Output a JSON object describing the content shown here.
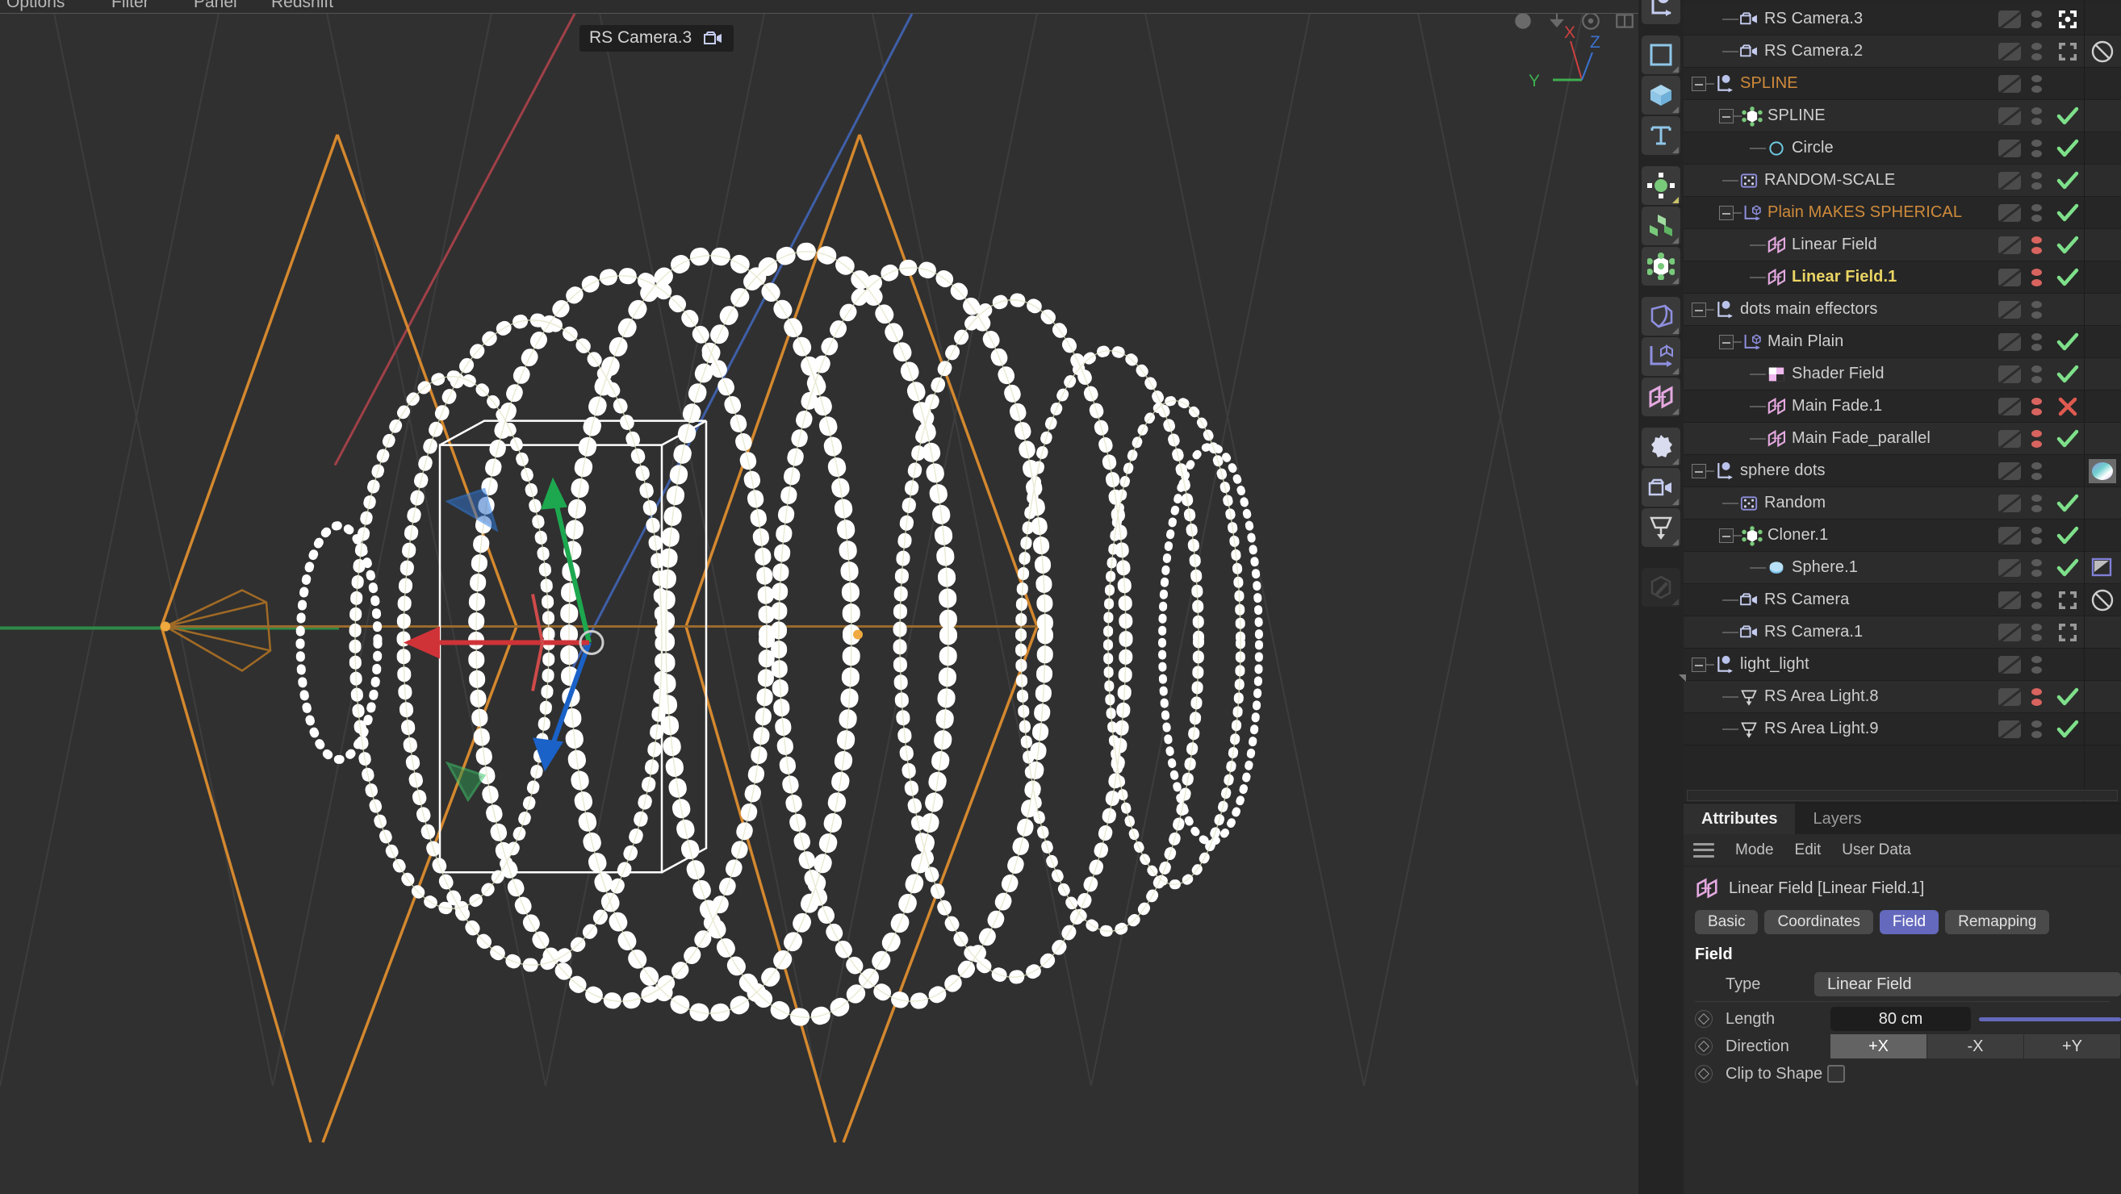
{
  "menubar": {
    "items": [
      "Options",
      "Filter",
      "Panel",
      "Redshift"
    ]
  },
  "viewport": {
    "camera_label": "RS Camera.3",
    "camera_icon": "camera-icon",
    "axis_gizmo": {
      "x": "X",
      "y": "Y",
      "z": "Z",
      "x_color": "#d0413f",
      "y_color": "#3fae4f",
      "z_color": "#3a73d0"
    },
    "top_icons": [
      "sphere-icon",
      "download-icon",
      "target-icon",
      "layout-icon"
    ],
    "background": "#303030",
    "grid_color": "#3d3d3d",
    "field_gizmo_color": "#d4882e",
    "clone_color": "#ffffff",
    "spline_color": "#e4e4c8"
  },
  "toolbar": {
    "items": [
      {
        "name": "null-object-icon",
        "color": "#c6cdf0",
        "group": 0
      },
      {
        "name": "plane-primitive-icon",
        "color": "#8fc6e8",
        "group": 1
      },
      {
        "name": "cube-primitive-icon",
        "color": "#8fc6e8",
        "group": 1
      },
      {
        "name": "text-primitive-icon",
        "color": "#8fc6e8",
        "group": 1
      },
      {
        "name": "mograph-array-icon",
        "color": "#78c97a",
        "group": 2
      },
      {
        "name": "mograph-clones-icon",
        "color": "#78c97a",
        "group": 2
      },
      {
        "name": "mograph-cloner-icon",
        "color": "#ffffff",
        "group": 2
      },
      {
        "name": "deformer-bend-icon",
        "color": "#8f8fe0",
        "group": 3
      },
      {
        "name": "effector-plain-icon",
        "color": "#8f8fe0",
        "group": 3
      },
      {
        "name": "linear-field-icon",
        "color": "#e4a9e0",
        "group": 3
      },
      {
        "name": "environment-icon",
        "color": "#c6cdf0",
        "group": 4
      },
      {
        "name": "camera-icon",
        "color": "#c6cdf0",
        "group": 4
      },
      {
        "name": "area-light-icon",
        "color": "#d5d5d5",
        "group": 4
      },
      {
        "name": "material-edit-icon",
        "color": "#5c5c5c",
        "group": 5
      }
    ]
  },
  "object_manager": {
    "rows": [
      {
        "label": "RS Camera.3",
        "icon": "camera-icon",
        "indent": 1,
        "expander": false,
        "color": "normal",
        "dots": "gray",
        "state": "frame-active",
        "extra": ""
      },
      {
        "label": "RS Camera.2",
        "icon": "camera-icon",
        "indent": 1,
        "expander": false,
        "color": "normal",
        "dots": "gray",
        "state": "frame",
        "extra": "no-icon"
      },
      {
        "label": "SPLINE",
        "icon": "null-object-icon",
        "indent": 0,
        "expander": true,
        "color": "orange",
        "dots": "gray",
        "state": "none",
        "extra": ""
      },
      {
        "label": "SPLINE",
        "icon": "cloner-icon",
        "indent": 1,
        "expander": true,
        "color": "normal",
        "dots": "gray",
        "state": "check",
        "extra": ""
      },
      {
        "label": "Circle",
        "icon": "circle-spline-icon",
        "indent": 2,
        "expander": false,
        "color": "normal",
        "dots": "gray",
        "state": "check",
        "extra": ""
      },
      {
        "label": "RANDOM-SCALE",
        "icon": "random-effector-icon",
        "indent": 1,
        "expander": false,
        "color": "normal",
        "dots": "gray",
        "state": "check",
        "extra": ""
      },
      {
        "label": "Plain MAKES SPHERICAL",
        "icon": "plain-effector-icon",
        "indent": 1,
        "expander": true,
        "color": "orange",
        "dots": "gray",
        "state": "check",
        "extra": ""
      },
      {
        "label": "Linear Field",
        "icon": "linear-field-icon",
        "indent": 2,
        "expander": false,
        "color": "normal",
        "dots": "red",
        "state": "check",
        "extra": ""
      },
      {
        "label": "Linear Field.1",
        "icon": "linear-field-icon",
        "indent": 2,
        "expander": false,
        "color": "yellow",
        "dots": "red",
        "state": "check",
        "extra": ""
      },
      {
        "label": "dots main effectors",
        "icon": "null-object-icon",
        "indent": 0,
        "expander": true,
        "color": "normal",
        "dots": "gray",
        "state": "none",
        "extra": ""
      },
      {
        "label": "Main Plain",
        "icon": "plain-effector-icon",
        "indent": 1,
        "expander": true,
        "color": "normal",
        "dots": "gray",
        "state": "check",
        "extra": ""
      },
      {
        "label": "Shader Field",
        "icon": "shader-field-icon",
        "indent": 2,
        "expander": false,
        "color": "normal",
        "dots": "gray",
        "state": "check",
        "extra": ""
      },
      {
        "label": "Main Fade.1",
        "icon": "linear-field-icon",
        "indent": 2,
        "expander": false,
        "color": "normal",
        "dots": "red",
        "state": "cross",
        "extra": ""
      },
      {
        "label": "Main Fade_parallel",
        "icon": "linear-field-icon",
        "indent": 2,
        "expander": false,
        "color": "normal",
        "dots": "red",
        "state": "check",
        "extra": ""
      },
      {
        "label": "sphere dots",
        "icon": "null-object-icon",
        "indent": 0,
        "expander": true,
        "color": "normal",
        "dots": "gray",
        "state": "none",
        "extra": "material-thumb"
      },
      {
        "label": "Random",
        "icon": "random-effector-icon",
        "indent": 1,
        "expander": false,
        "color": "normal",
        "dots": "gray",
        "state": "check",
        "extra": ""
      },
      {
        "label": "Cloner.1",
        "icon": "cloner-icon",
        "indent": 1,
        "expander": true,
        "color": "normal",
        "dots": "gray",
        "state": "check",
        "extra": ""
      },
      {
        "label": "Sphere.1",
        "icon": "sphere-primitive-icon",
        "indent": 2,
        "expander": false,
        "color": "normal",
        "dots": "gray",
        "state": "check",
        "extra": "flag-tag"
      },
      {
        "label": "RS Camera",
        "icon": "camera-icon",
        "indent": 1,
        "expander": false,
        "color": "normal",
        "dots": "gray",
        "state": "frame",
        "extra": "no-icon"
      },
      {
        "label": "RS Camera.1",
        "icon": "camera-icon",
        "indent": 1,
        "expander": false,
        "color": "normal",
        "dots": "gray",
        "state": "frame",
        "extra": ""
      },
      {
        "label": "light_light",
        "icon": "null-object-icon",
        "indent": 0,
        "expander": true,
        "color": "normal",
        "dots": "gray",
        "state": "none",
        "extra": ""
      },
      {
        "label": "RS Area Light.8",
        "icon": "area-light-icon",
        "indent": 1,
        "expander": false,
        "color": "normal",
        "dots": "red",
        "state": "check",
        "extra": ""
      },
      {
        "label": "RS Area Light.9",
        "icon": "area-light-icon",
        "indent": 1,
        "expander": false,
        "color": "normal",
        "dots": "gray",
        "state": "check",
        "extra": ""
      }
    ]
  },
  "attributes": {
    "tabs": [
      {
        "label": "Attributes",
        "active": true
      },
      {
        "label": "Layers",
        "active": false
      }
    ],
    "menu": [
      "Mode",
      "Edit",
      "User Data"
    ],
    "object_title": "Linear Field [Linear Field.1]",
    "object_icon": "linear-field-icon",
    "pills": [
      {
        "label": "Basic",
        "selected": false
      },
      {
        "label": "Coordinates",
        "selected": false
      },
      {
        "label": "Field",
        "selected": true
      },
      {
        "label": "Remapping",
        "selected": false
      }
    ],
    "section_title": "Field",
    "props": {
      "type_label": "Type",
      "type_value": "Linear Field",
      "length_label": "Length",
      "length_value": "80 cm",
      "direction_label": "Direction",
      "direction_options": [
        "+X",
        "-X",
        "+Y"
      ],
      "direction_selected": "+X",
      "clip_label": "Clip to Shape",
      "clip_checked": false
    },
    "accent_color": "#6469bd"
  }
}
